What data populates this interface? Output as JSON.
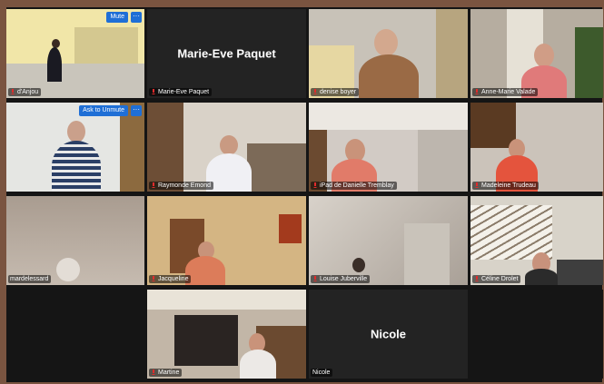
{
  "participants": [
    {
      "name": "d'Anjou",
      "muted": true,
      "buttons": [
        "Mute",
        "···"
      ],
      "active": true
    },
    {
      "name": "Marie-Eve Paquet",
      "muted": true,
      "video": false,
      "center_label": "Marie-Eve Paquet"
    },
    {
      "name": "denise boyer",
      "muted": true
    },
    {
      "name": "Anne-Marie Valade",
      "muted": true
    },
    {
      "name": "",
      "muted": false,
      "buttons": [
        "Ask to Unmute",
        "···"
      ]
    },
    {
      "name": "Raymonde Emond",
      "muted": true
    },
    {
      "name": "iPad de Danielle Tremblay",
      "muted": true
    },
    {
      "name": "Madeleine Trudeau",
      "muted": true
    },
    {
      "name": "mardelessard",
      "muted": false
    },
    {
      "name": "Jacqueline",
      "muted": true
    },
    {
      "name": "Louise Juberville",
      "muted": true
    },
    {
      "name": "Céline Drolet",
      "muted": true
    },
    {
      "name": "",
      "empty": true
    },
    {
      "name": "Martine",
      "muted": true
    },
    {
      "name": "Nicole",
      "muted": false,
      "video": false,
      "center_label": "Nicole"
    },
    {
      "name": "",
      "empty": true
    }
  ],
  "colors": {
    "active_speaker": "#f3e00b",
    "button_blue": "#1f6fd6",
    "background": "#151515",
    "muted_icon": "#e02b2b"
  }
}
